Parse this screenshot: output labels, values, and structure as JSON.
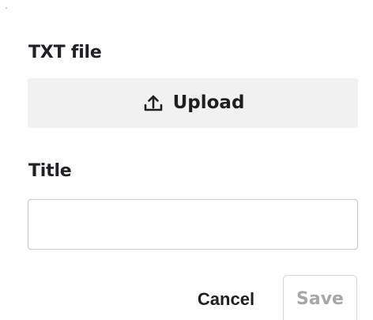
{
  "form": {
    "file_label": "TXT file",
    "upload_label": "Upload",
    "title_label": "Title",
    "title_value": "",
    "title_placeholder": ""
  },
  "actions": {
    "cancel_label": "Cancel",
    "save_label": "Save",
    "save_disabled": true
  },
  "icons": {
    "upload": "upload-icon"
  }
}
